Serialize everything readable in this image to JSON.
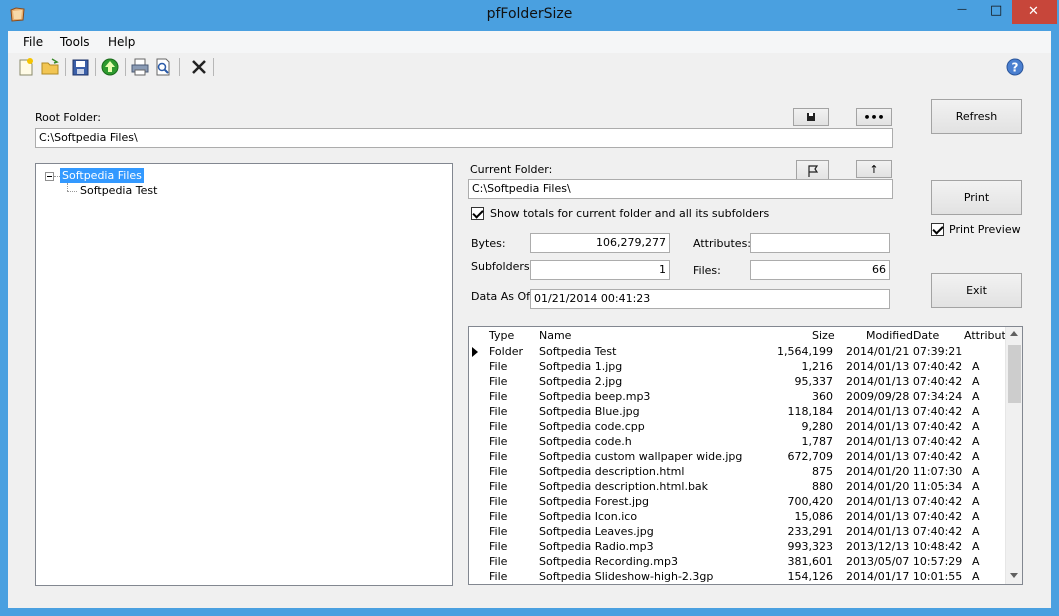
{
  "window": {
    "title": "pfFolderSize",
    "close_glyph": "✕",
    "max_glyph": "□",
    "min_glyph": "—"
  },
  "menu": [
    "File",
    "Tools",
    "Help"
  ],
  "toolbar": {
    "icons": [
      "new-icon",
      "open-folder-icon",
      "save-icon",
      "up-arrow-icon",
      "print-icon",
      "print-preview-icon",
      "delete-icon",
      "help-icon"
    ]
  },
  "root_folder": {
    "label": "Root Folder:",
    "value": "C:\\Softpedia Files\\",
    "browse_label": "•••"
  },
  "tree": {
    "root": "Softpedia Files",
    "children": [
      "Softpedia Test"
    ]
  },
  "current_folder": {
    "label": "Current Folder:",
    "value": "C:\\Softpedia Files\\",
    "up_label": "↑"
  },
  "show_totals": {
    "label": "Show totals for current folder and all its subfolders",
    "checked": true
  },
  "fields": {
    "bytes_label": "Bytes:",
    "bytes_value": "106,279,277",
    "attributes_label": "Attributes:",
    "attributes_value": "",
    "subfolders_label": "Subfolders:",
    "subfolders_value": "1",
    "files_label": "Files:",
    "files_value": "66",
    "data_as_of_label": "Data As Of:",
    "data_as_of_value": "01/21/2014 00:41:23"
  },
  "buttons": {
    "refresh": "Refresh",
    "print": "Print",
    "print_preview": "Print Preview",
    "exit": "Exit"
  },
  "list": {
    "columns": [
      "Type",
      "Name",
      "Size",
      "ModifiedDate",
      "Attributes"
    ],
    "rows": [
      {
        "type": "Folder",
        "name": "Softpedia Test",
        "size": "1,564,199",
        "date": "2014/01/21 07:39:21",
        "attr": ""
      },
      {
        "type": "File",
        "name": "Softpedia 1.jpg",
        "size": "1,216",
        "date": "2014/01/13 07:40:42",
        "attr": "A"
      },
      {
        "type": "File",
        "name": "Softpedia 2.jpg",
        "size": "95,337",
        "date": "2014/01/13 07:40:42",
        "attr": "A"
      },
      {
        "type": "File",
        "name": "Softpedia beep.mp3",
        "size": "360",
        "date": "2009/09/28 07:34:24",
        "attr": "A"
      },
      {
        "type": "File",
        "name": "Softpedia Blue.jpg",
        "size": "118,184",
        "date": "2014/01/13 07:40:42",
        "attr": "A"
      },
      {
        "type": "File",
        "name": "Softpedia code.cpp",
        "size": "9,280",
        "date": "2014/01/13 07:40:42",
        "attr": "A"
      },
      {
        "type": "File",
        "name": "Softpedia code.h",
        "size": "1,787",
        "date": "2014/01/13 07:40:42",
        "attr": "A"
      },
      {
        "type": "File",
        "name": "Softpedia custom wallpaper wide.jpg",
        "size": "672,709",
        "date": "2014/01/13 07:40:42",
        "attr": "A"
      },
      {
        "type": "File",
        "name": "Softpedia description.html",
        "size": "875",
        "date": "2014/01/20 11:07:30",
        "attr": "A"
      },
      {
        "type": "File",
        "name": "Softpedia description.html.bak",
        "size": "880",
        "date": "2014/01/20 11:05:34",
        "attr": "A"
      },
      {
        "type": "File",
        "name": "Softpedia Forest.jpg",
        "size": "700,420",
        "date": "2014/01/13 07:40:42",
        "attr": "A"
      },
      {
        "type": "File",
        "name": "Softpedia Icon.ico",
        "size": "15,086",
        "date": "2014/01/13 07:40:42",
        "attr": "A"
      },
      {
        "type": "File",
        "name": "Softpedia Leaves.jpg",
        "size": "233,291",
        "date": "2014/01/13 07:40:42",
        "attr": "A"
      },
      {
        "type": "File",
        "name": "Softpedia Radio.mp3",
        "size": "993,323",
        "date": "2013/12/13 10:48:42",
        "attr": "A"
      },
      {
        "type": "File",
        "name": "Softpedia Recording.mp3",
        "size": "381,601",
        "date": "2013/05/07 10:57:29",
        "attr": "A"
      },
      {
        "type": "File",
        "name": "Softpedia Slideshow-high-2.3gp",
        "size": "154,126",
        "date": "2014/01/17 10:01:55",
        "attr": "A"
      }
    ]
  },
  "colors": {
    "titlebar": "#4aa0e0",
    "selection": "#3399ff",
    "close_button": "#c7463a"
  }
}
